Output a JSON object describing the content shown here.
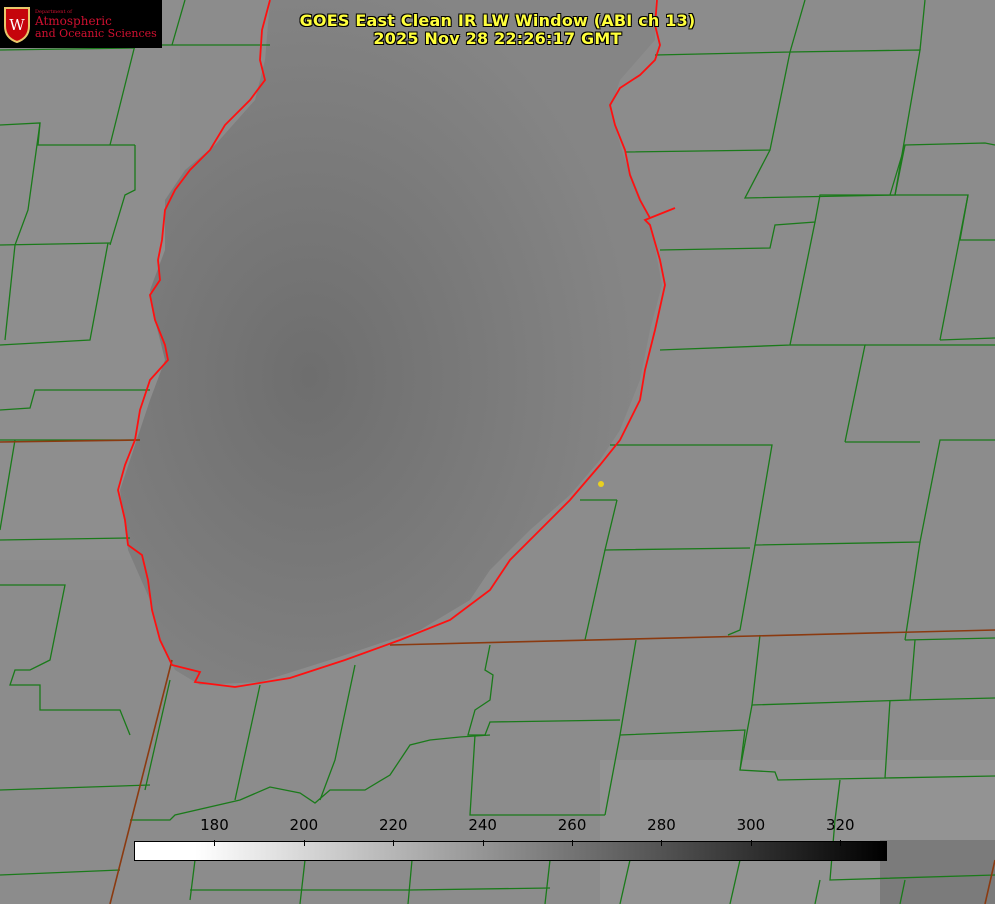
{
  "title": {
    "line1": "GOES East Clean IR LW Window (ABI ch 13)",
    "line2": "2025 Nov 28 22:26:17 GMT",
    "color": "#ffff3c"
  },
  "logo": {
    "department": "Department of",
    "line1": "Atmospheric",
    "line2": "and Oceanic Sciences",
    "seal_letter": "W",
    "color": "#d01030"
  },
  "colorbar": {
    "ticks": [
      "180",
      "200",
      "220",
      "240",
      "260",
      "280",
      "300",
      "320"
    ],
    "range": [
      162,
      330
    ]
  },
  "map": {
    "county_line_color": "#1a7a1a",
    "state_line_color": "#8b3a10",
    "coastline_color": "#ff1010",
    "marker_color": "#e8d020"
  }
}
